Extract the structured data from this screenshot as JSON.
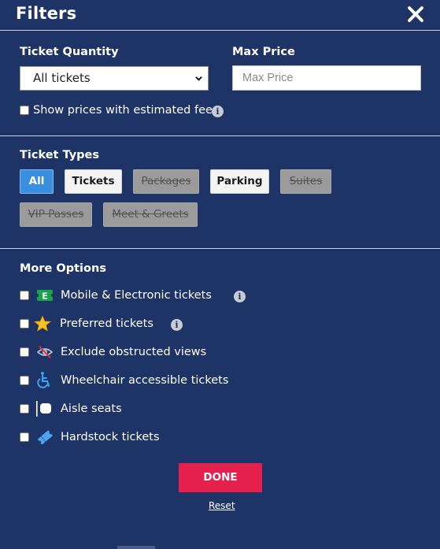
{
  "header": {
    "title": "Filters",
    "close_icon": "close-icon"
  },
  "quantity": {
    "label": "Ticket Quantity",
    "selected": "All tickets"
  },
  "price": {
    "label": "Max Price",
    "placeholder": "Max Price",
    "value": ""
  },
  "fees": {
    "label": "Show prices with estimated fees",
    "checked": false
  },
  "ticket_types": {
    "label": "Ticket Types",
    "chips": [
      {
        "label": "All",
        "state": "active"
      },
      {
        "label": "Tickets",
        "state": "enabled"
      },
      {
        "label": "Packages",
        "state": "disabled"
      },
      {
        "label": "Parking",
        "state": "enabled"
      },
      {
        "label": "Suites",
        "state": "disabled"
      },
      {
        "label": "VIP Passes",
        "state": "disabled"
      },
      {
        "label": "Meet & Greets",
        "state": "disabled"
      }
    ]
  },
  "more_options": {
    "label": "More Options",
    "items": [
      {
        "label": "Mobile & Electronic tickets",
        "icon": "electronic-ticket-icon",
        "info": true
      },
      {
        "label": "Preferred tickets",
        "icon": "star-icon",
        "info": true
      },
      {
        "label": "Exclude obstructed views",
        "icon": "obstructed-view-icon",
        "info": false
      },
      {
        "label": "Wheelchair accessible tickets",
        "icon": "wheelchair-icon",
        "info": false
      },
      {
        "label": "Aisle seats",
        "icon": "aisle-seat-icon",
        "info": false
      },
      {
        "label": "Hardstock tickets",
        "icon": "hardstock-ticket-icon",
        "info": false
      }
    ]
  },
  "actions": {
    "done_label": "DONE",
    "reset_label": "Reset"
  },
  "colors": {
    "background": "#1e3366",
    "accent": "#3a8fe0",
    "done": "#e6204d"
  }
}
